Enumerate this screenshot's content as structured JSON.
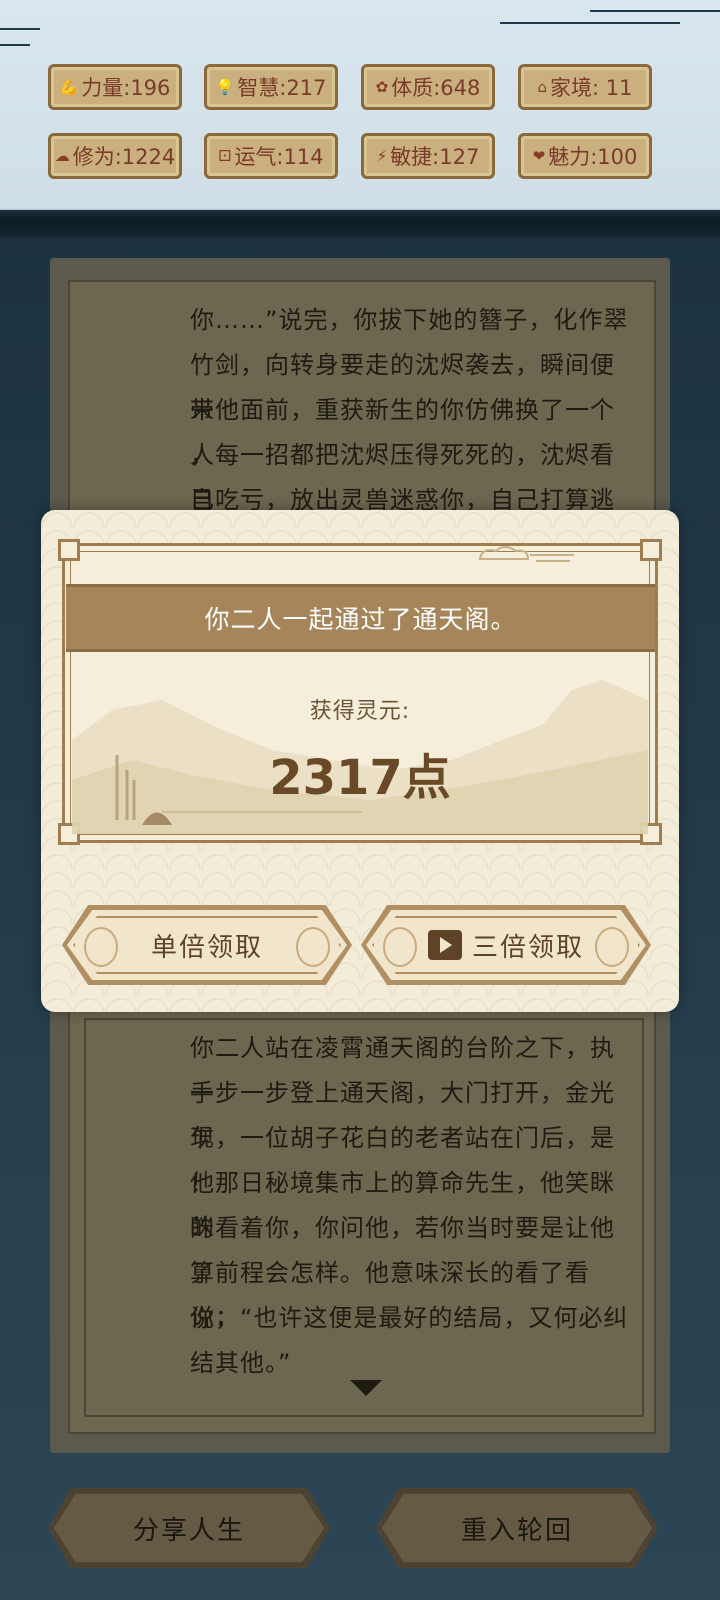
{
  "stats": [
    {
      "icon": "arm-icon",
      "glyph": "💪",
      "label": "力量:196"
    },
    {
      "icon": "bulb-icon",
      "glyph": "💡",
      "label": "智慧:217"
    },
    {
      "icon": "body-icon",
      "glyph": "✿",
      "label": "体质:648"
    },
    {
      "icon": "home-icon",
      "glyph": "⌂",
      "label": "家境: 11"
    },
    {
      "icon": "cloud-icon",
      "glyph": "☁",
      "label": "修为:1224"
    },
    {
      "icon": "dice-icon",
      "glyph": "⚀",
      "label": "运气:114"
    },
    {
      "icon": "lightning-icon",
      "glyph": "⚡",
      "label": "敏捷:127"
    },
    {
      "icon": "heart-icon",
      "glyph": "❤",
      "label": "魅力:100"
    }
  ],
  "story": {
    "top": [
      "你……”说完，你拔下她的簪子，化作翠",
      "竹剑，向转身要走的沈烬袭去，瞬间便来",
      "带他面前，重获新生的你仿佛换了一个人",
      "，每一招都把沈烬压得死死的，沈烬看自",
      "己吃亏，放出灵兽迷惑你，自己打算逃跑"
    ],
    "bottom": [
      "你二人站在凌霄通天阁的台阶之下，执手",
      "一步一步登上通天阁，大门打开，金光乍",
      "现，一位胡子花白的老者站在门后，是他",
      "！那日秘境集市上的算命先生，他笑眯眯",
      "的看着你，你问他，若你当时要是让他算",
      "了前程会怎样。他意味深长的看了看你，",
      "说：“也许这便是最好的结局，又何必纠",
      "结其他。”"
    ]
  },
  "modal": {
    "title": "你二人一起通过了通天阁。",
    "reward_label": "获得灵元:",
    "reward_value": "2317点",
    "single_button": "单倍领取",
    "triple_button": "三倍领取"
  },
  "bottom_buttons": {
    "share": "分享人生",
    "restart": "重入轮回"
  }
}
